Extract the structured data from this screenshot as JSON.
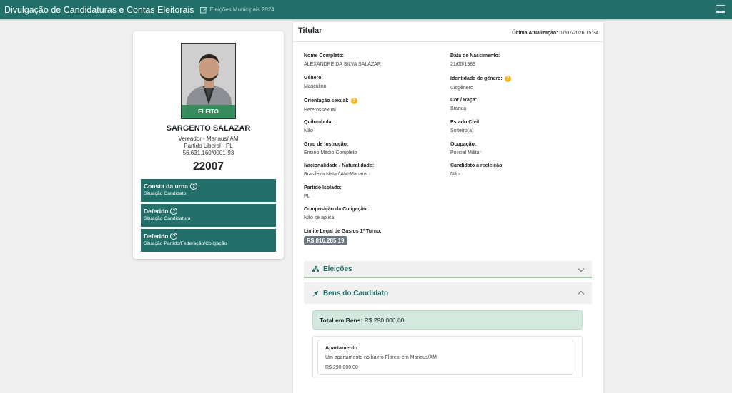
{
  "navbar": {
    "title": "Divulgação de Candidaturas e Contas Eleitorais",
    "election": "Eleições Municipais 2024"
  },
  "candidate": {
    "status_badge": "ELEITO",
    "name": "SARGENTO SALAZAR",
    "office": "Vereador - Manaus/ AM",
    "party": "Partido Liberal - PL",
    "cnpj": "56.631.160/0001-93",
    "number": "22007",
    "situations": [
      {
        "title": "Consta da urna",
        "subtitle": "Situação Candidato"
      },
      {
        "title": "Deferido",
        "subtitle": "Situação Candidatura"
      },
      {
        "title": "Deferido",
        "subtitle": "Situação Partido/Federação/Coligação"
      }
    ]
  },
  "details": {
    "header": "Titular",
    "last_update_label": "Última Atualização:",
    "last_update_value": "07/07/2026 15:34",
    "fields": {
      "nome_label": "Nome Completo:",
      "nome": "ALEXANDRE DA SILVA SALAZAR",
      "nasc_label": "Data de Nascimento:",
      "nasc": "21/05/1983",
      "genero_label": "Gênero:",
      "genero": "Masculino",
      "identidade_label": "Identidade de gênero:",
      "identidade": "Cisgênero",
      "orientacao_label": "Orientação sexual:",
      "orientacao": "Heterossexual",
      "cor_label": "Cor / Raça:",
      "cor": "Branca",
      "quilombola_label": "Quilombola:",
      "quilombola": "Não",
      "estado_label": "Estado Civil:",
      "estado": "Solteiro(a)",
      "grau_label": "Grau de Instrução:",
      "grau": "Ensino Médio Completo",
      "ocupacao_label": "Ocupação:",
      "ocupacao": "Policial Militar",
      "nacionalidade_label": "Nacionalidade / Naturalidade:",
      "nacionalidade": "Brasileira Nata / AM-Manaus",
      "reeleicao_label": "Candidato a reeleição:",
      "reeleicao": "Não",
      "partido_label": "Partido Isolado:",
      "partido": "PL",
      "coligacao_label": "Composição da Coligação:",
      "coligacao": "Não se aplica",
      "limite_label": "Limite Legal de Gastos 1º Turno:",
      "limite": "R$ 816.285,19"
    }
  },
  "accordions": {
    "eleicoes": "Eleições",
    "bens": "Bens do Candidato"
  },
  "bens": {
    "total_label": "Total em Bens:",
    "total_value": "R$ 290.000,00",
    "items": [
      {
        "title": "Apartamento",
        "description": "Um apartamento no bairro Flores, em Manaus/AM",
        "value": "R$ 290.000,00"
      }
    ]
  }
}
